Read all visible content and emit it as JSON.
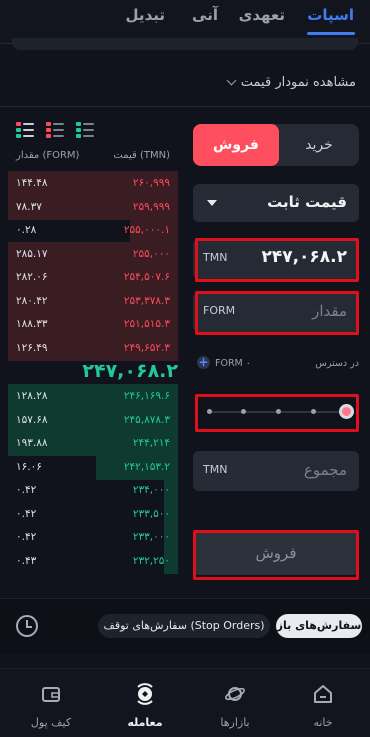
{
  "top_tabs": [
    {
      "label": "اسپات",
      "active": true
    },
    {
      "label": "تعهدی",
      "active": false
    },
    {
      "label": "آنی",
      "active": false
    },
    {
      "label": "تبدیل",
      "active": false
    }
  ],
  "chart_toggle": {
    "label": "مشاهده نمودار قیمت",
    "icon": "chevron-down-icon"
  },
  "order_book": {
    "view_icons": [
      "book-both-icon",
      "book-asks-icon",
      "book-bids-icon"
    ],
    "headers": {
      "amount": "مقدار (FORM)",
      "price": "قیمت (TMN)"
    },
    "asks": [
      {
        "amount": "۱۴۴.۴۸",
        "price": "۲۶۰,۹۹۹",
        "depth": 1.0
      },
      {
        "amount": "۷۸.۳۷",
        "price": "۲۵۹,۹۹۹",
        "depth": 1.0
      },
      {
        "amount": "۰.۲۸",
        "price": "۲۵۵,۰۰۰.۱",
        "depth": 0.28
      },
      {
        "amount": "۲۸۵.۱۷",
        "price": "۲۵۵,۰۰۰",
        "depth": 1.0
      },
      {
        "amount": "۲۸۲.۰۶",
        "price": "۲۵۴,۵۰۷.۶",
        "depth": 1.0
      },
      {
        "amount": "۲۸۰.۴۲",
        "price": "۲۵۳,۳۷۸.۳",
        "depth": 1.0
      },
      {
        "amount": "۱۸۸.۳۳",
        "price": "۲۵۱,۵۱۵.۳",
        "depth": 1.0
      },
      {
        "amount": "۱۲۶.۴۹",
        "price": "۲۴۹,۶۵۲.۳",
        "depth": 1.0
      }
    ],
    "last_price": "۲۴۷,۰۶۸.۲",
    "bids": [
      {
        "amount": "۱۲۸.۲۸",
        "price": "۲۴۶,۱۶۹.۶",
        "depth": 1.0
      },
      {
        "amount": "۱۵۷.۶۸",
        "price": "۲۴۵,۸۷۸.۳",
        "depth": 1.0
      },
      {
        "amount": "۱۹۳.۸۸",
        "price": "۲۴۴,۲۱۴",
        "depth": 1.0
      },
      {
        "amount": "۱۶.۰۶",
        "price": "۲۴۲,۱۵۳.۲",
        "depth": 0.48
      },
      {
        "amount": "۰.۴۲",
        "price": "۲۳۴,۰۰۰",
        "depth": 0.08
      },
      {
        "amount": "۰.۴۲",
        "price": "۲۳۳,۵۰۰",
        "depth": 0.08
      },
      {
        "amount": "۰.۴۲",
        "price": "۲۳۳,۰۰۰",
        "depth": 0.08
      },
      {
        "amount": "۰.۴۳",
        "price": "۲۳۲,۲۵۰",
        "depth": 0.08
      }
    ]
  },
  "order_form": {
    "buy_label": "خرید",
    "sell_label": "فروش",
    "selected_side": "sell",
    "order_type": "قیمت ثابت",
    "price_field": {
      "unit": "TMN",
      "value": "۲۴۷,۰۶۸.۲"
    },
    "amount_field": {
      "unit": "FORM",
      "placeholder": "مقدار"
    },
    "available": {
      "label": "در دسترس",
      "amount": "FORM ۰"
    },
    "slider": {
      "value_percent": 100
    },
    "total_field": {
      "unit": "TMN",
      "placeholder": "مجموع"
    },
    "submit_label": "فروش"
  },
  "orders_bar": {
    "open_orders": "سفارش‌های باز",
    "stop_orders": "سفارش‌های توقف (Stop Orders)",
    "history_icon": "history-icon"
  },
  "bottom_nav": [
    {
      "label": "خانه",
      "icon": "home-icon",
      "active": false
    },
    {
      "label": "بازارها",
      "icon": "planet-icon",
      "active": false
    },
    {
      "label": "معامله",
      "icon": "trade-icon",
      "active": true
    },
    {
      "label": "کیف پول",
      "icon": "wallet-icon",
      "active": false
    }
  ],
  "colors": {
    "accent": "#3f7df0",
    "sell": "#ff4f5e",
    "buy": "#20c997",
    "highlight": "#e0101a"
  }
}
